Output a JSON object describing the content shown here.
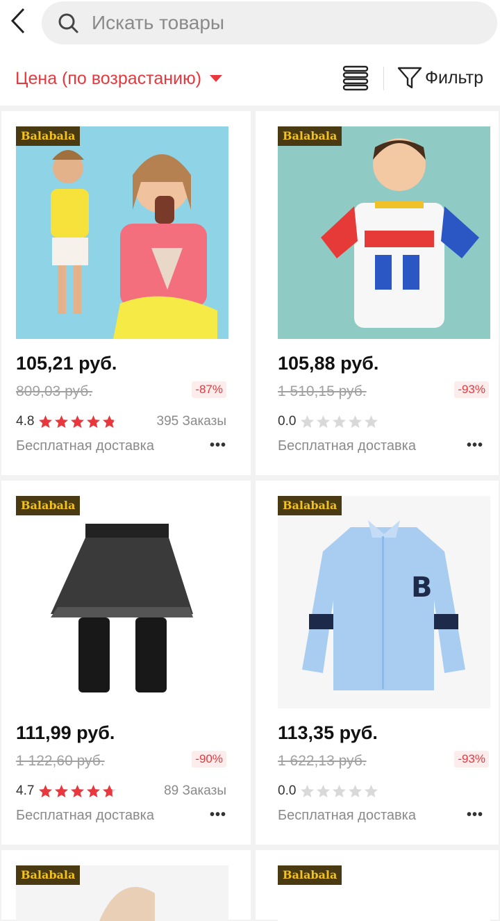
{
  "header": {
    "search_placeholder": "Искать товары",
    "sort_label": "Цена (по возрастанию)",
    "filter_label": "Фильтр"
  },
  "products": [
    {
      "brand": "Balabala",
      "image": "girls-tshirts-icecream",
      "price": "105,21 руб.",
      "old_price": "809,03 руб.",
      "discount": "-87%",
      "rating": "4.8",
      "stars": 4.8,
      "orders": "395 Заказы",
      "shipping": "Бесплатная доставка"
    },
    {
      "brand": "Balabala",
      "image": "boy-tshirt-colorblock",
      "price": "105,88 руб.",
      "old_price": "1 510,15 руб.",
      "discount": "-93%",
      "rating": "0.0",
      "stars": 0,
      "orders": "",
      "shipping": "Бесплатная доставка"
    },
    {
      "brand": "Balabala",
      "image": "tutu-skirt-leggings",
      "price": "111,99 руб.",
      "old_price": "1 122,60 руб.",
      "discount": "-90%",
      "rating": "4.7",
      "stars": 4.7,
      "orders": "89 Заказы",
      "shipping": "Бесплатная доставка"
    },
    {
      "brand": "Balabala",
      "image": "light-blue-shirt",
      "price": "113,35 руб.",
      "old_price": "1 622,13 руб.",
      "discount": "-93%",
      "rating": "0.0",
      "stars": 0,
      "orders": "",
      "shipping": "Бесплатная доставка"
    },
    {
      "brand": "Balabala",
      "image": "partial-product-5"
    },
    {
      "brand": "Balabala",
      "image": "partial-product-6"
    }
  ],
  "colors": {
    "accent": "#e8383d",
    "star_filled": "#e8383d",
    "star_empty": "#d9d9d9",
    "brand_badge_bg": "#4a3a12",
    "brand_badge_text": "#f3c21b"
  }
}
